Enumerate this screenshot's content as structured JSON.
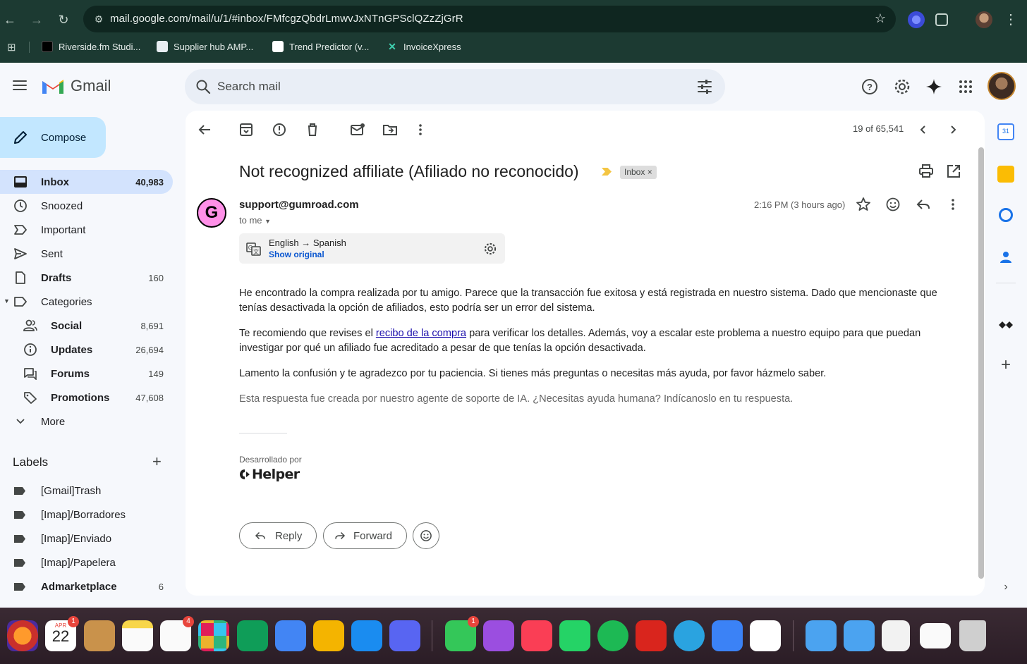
{
  "browser": {
    "url": "mail.google.com/mail/u/1/#inbox/FMfcgzQbdrLmwvJxNTnGPSclQZzZjGrR",
    "bookmarks": [
      "Riverside.fm Studi...",
      "Supplier hub AMP...",
      "Trend Predictor (v...",
      "InvoiceXpress"
    ]
  },
  "gmail": {
    "brand": "Gmail",
    "search_placeholder": "Search mail",
    "compose_label": "Compose",
    "nav": [
      {
        "label": "Inbox",
        "count": "40,983"
      },
      {
        "label": "Snoozed",
        "count": ""
      },
      {
        "label": "Important",
        "count": ""
      },
      {
        "label": "Sent",
        "count": ""
      },
      {
        "label": "Drafts",
        "count": "160"
      },
      {
        "label": "Categories",
        "count": ""
      },
      {
        "label": "Social",
        "count": "8,691"
      },
      {
        "label": "Updates",
        "count": "26,694"
      },
      {
        "label": "Forums",
        "count": "149"
      },
      {
        "label": "Promotions",
        "count": "47,608"
      },
      {
        "label": "More",
        "count": ""
      }
    ],
    "labels_title": "Labels",
    "labels": [
      {
        "label": "[Gmail]Trash",
        "count": ""
      },
      {
        "label": "[Imap]/Borradores",
        "count": ""
      },
      {
        "label": "[Imap]/Enviado",
        "count": ""
      },
      {
        "label": "[Imap]/Papelera",
        "count": ""
      },
      {
        "label": "Admarketplace",
        "count": "6"
      }
    ]
  },
  "message": {
    "pager": "19 of 65,541",
    "subject": "Not recognized affiliate (Afiliado no reconocido)",
    "chip": "Inbox",
    "chip_close": "×",
    "sender_initial": "G",
    "sender": "support@gumroad.com",
    "to": "to me",
    "time": "2:16 PM (3 hours ago)",
    "translate_from": "English",
    "translate_arrow": "→",
    "translate_to": "Spanish",
    "show_original": "Show original",
    "p1": "He encontrado la compra realizada por tu amigo. Parece que la transacción fue exitosa y está registrada en nuestro sistema. Dado que mencionaste que tenías desactivada la opción de afiliados, esto podría ser un error del sistema.",
    "p2_before": "Te recomiendo que revises el ",
    "p2_link": "recibo de la compra",
    "p2_after": " para verificar los detalles. Además, voy a escalar este problema a nuestro equipo para que puedan investigar por qué un afiliado fue acreditado a pesar de que tenías la opción desactivada.",
    "p3": "Lamento la confusión y te agradezco por tu paciencia. Si tienes más preguntas o necesitas más ayuda, por favor házmelo saber.",
    "p4": "Esta respuesta fue creada por nuestro agente de soporte de IA. ¿Necesitas ayuda humana? Indícanoslo en tu respuesta.",
    "developed_by": "Desarrollado por",
    "helper_brand": "Helper",
    "reply": "Reply",
    "forward": "Forward"
  },
  "dock": {
    "calendar_month": "APR",
    "calendar_day": "22",
    "badges": {
      "calendar": "1",
      "reminders": "4",
      "messages": "1"
    }
  },
  "colors": {
    "chrome": "#1c3a32",
    "gmail_bg": "#f6f8fc",
    "compose": "#c2e7ff",
    "active_nav": "#d3e3fd",
    "gumroad_pink": "#ff90e8",
    "link": "#1a0dab"
  }
}
